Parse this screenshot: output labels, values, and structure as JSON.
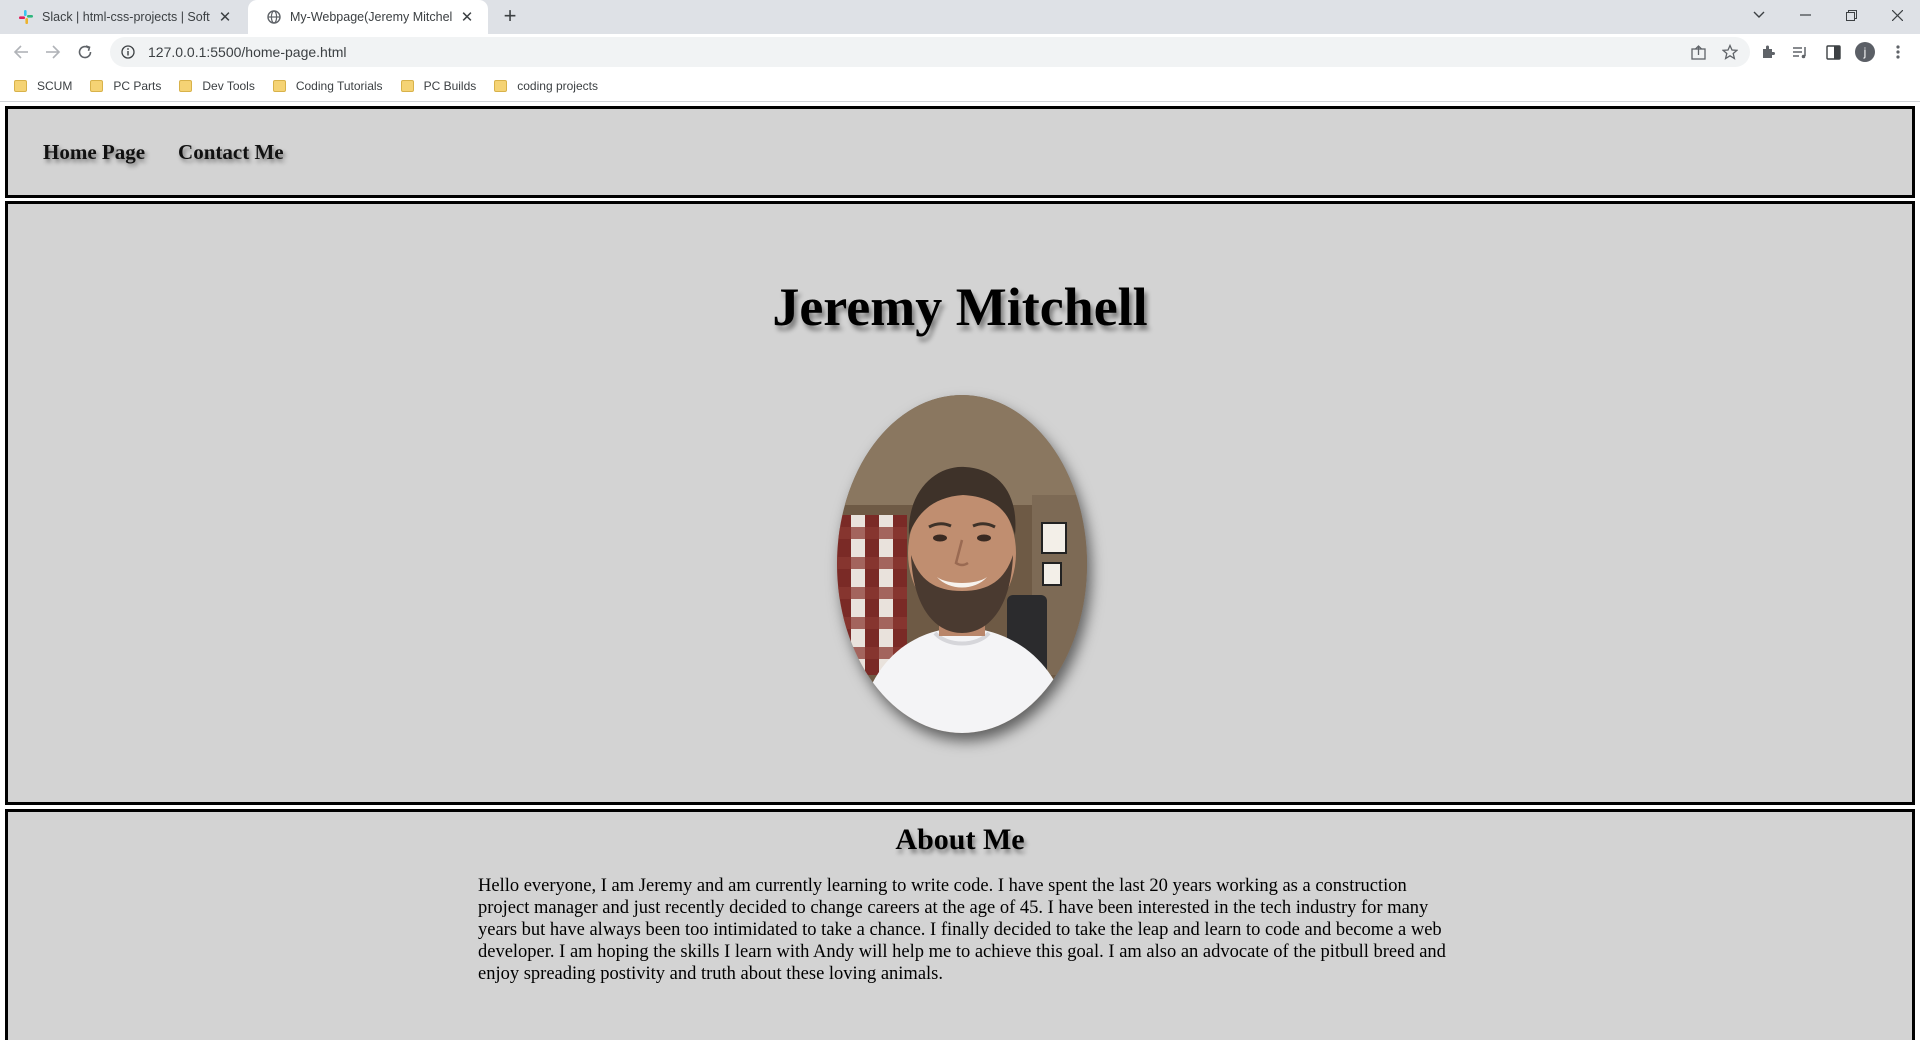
{
  "browser": {
    "tabs": [
      {
        "title": "Slack | html-css-projects | Software",
        "favicon": "slack-icon",
        "active": false
      },
      {
        "title": "My-Webpage(Jeremy Mitchell)",
        "favicon": "globe-icon",
        "active": true
      }
    ],
    "new_tab_label": "+",
    "url": "127.0.0.1:5500/home-page.html",
    "bookmarks": [
      "SCUM",
      "PC Parts",
      "Dev Tools",
      "Coding Tutorials",
      "PC Builds",
      "coding projects"
    ],
    "profile_initial": "j",
    "toolbar_icons": [
      "share-icon",
      "star-icon",
      "extensions-icon",
      "media-icon",
      "side-panel-icon",
      "avatar",
      "menu-icon"
    ]
  },
  "page": {
    "nav": [
      "Home Page",
      "Contact Me"
    ],
    "hero_title": "Jeremy Mitchell",
    "about_heading": "About Me",
    "about_text": "Hello everyone, I am Jeremy and am currently learning to write code. I have spent the last 20 years working as a construction project manager and just recently decided to change careers at the age of 45. I have been interested in the tech industry for many years but have always been too intimidated to take a chance. I finally decided to take the leap and learn to code and become a web developer. I am hoping the skills I learn with Andy will help me to achieve this goal. I am also an advocate of the pitbull breed and enjoy spreading postivity and truth about these loving animals."
  },
  "colors": {
    "section_bg": "#d3d3d3",
    "section_border": "#000000",
    "tabstrip_bg": "#dee1e6",
    "folder_yellow": "#f5d374"
  }
}
